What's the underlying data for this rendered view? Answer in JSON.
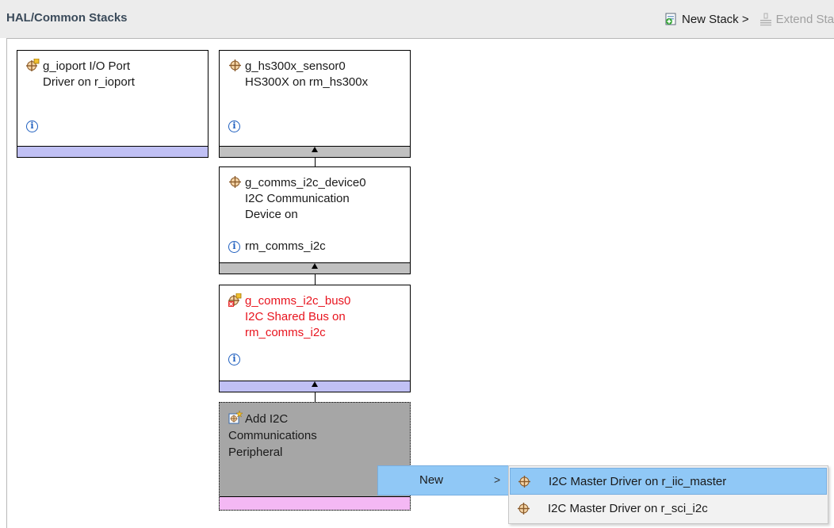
{
  "header": {
    "title": "HAL/Common Stacks",
    "new_stack_label": "New Stack >",
    "extend_stack_label": "Extend Sta"
  },
  "blocks": {
    "ioport": {
      "line1": "g_ioport I/O Port",
      "line2": "Driver on r_ioport",
      "info": "i"
    },
    "sensor": {
      "line1": "g_hs300x_sensor0",
      "line2": "HS300X on rm_hs300x",
      "info": "i"
    },
    "device": {
      "line1": "g_comms_i2c_device0",
      "line2": "I2C Communication",
      "line3": "Device on",
      "line4": "rm_comms_i2c",
      "info": "i"
    },
    "bus": {
      "line1": "g_comms_i2c_bus0",
      "line2": "I2C Shared Bus on",
      "line3": "rm_comms_i2c",
      "info": "i"
    },
    "add": {
      "line1": "Add I2C",
      "line2": "Communications",
      "line3": "Peripheral"
    }
  },
  "context_menu": {
    "new_label": "New",
    "chevron": ">",
    "items": [
      {
        "label": "I2C Master Driver on r_iic_master",
        "selected": true
      },
      {
        "label": "I2C Master Driver on r_sci_i2c",
        "selected": false
      }
    ]
  },
  "colors": {
    "error_text": "#e8141e",
    "selection": "#90c8f6",
    "bar_lavender": "#c0c0f4",
    "bar_gray": "#c0c0c0",
    "bar_pink": "#f4b8f4",
    "add_block_bg": "#a6a6a6"
  },
  "icons": {
    "module": "module-crosshair-icon",
    "module_error": "module-error-icon",
    "add": "add-module-icon",
    "info": "info-icon",
    "new_stack": "new-stack-icon",
    "extend_stack": "extend-stack-icon"
  }
}
